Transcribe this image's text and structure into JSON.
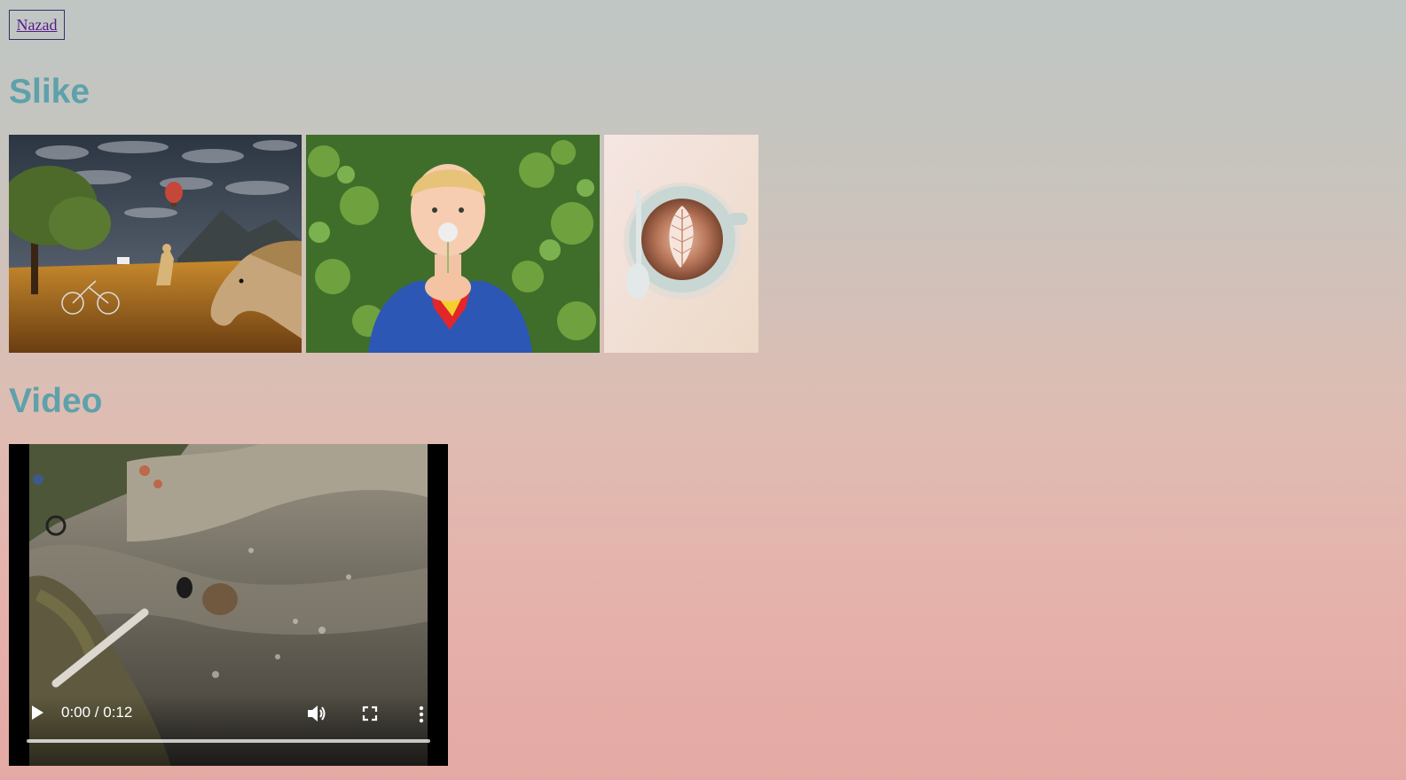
{
  "nav": {
    "back_label": "Nazad"
  },
  "sections": {
    "images_title": "Slike",
    "video_title": "Video"
  },
  "images": [
    {
      "icon": "landscape-horse-balloon-image"
    },
    {
      "icon": "boy-with-dandelion-image"
    },
    {
      "icon": "latte-art-cup-image"
    }
  ],
  "video": {
    "time": "0:00 / 0:12",
    "progress": 0
  },
  "colors": {
    "heading": "#5ea1ab",
    "link": "#551a8b"
  }
}
